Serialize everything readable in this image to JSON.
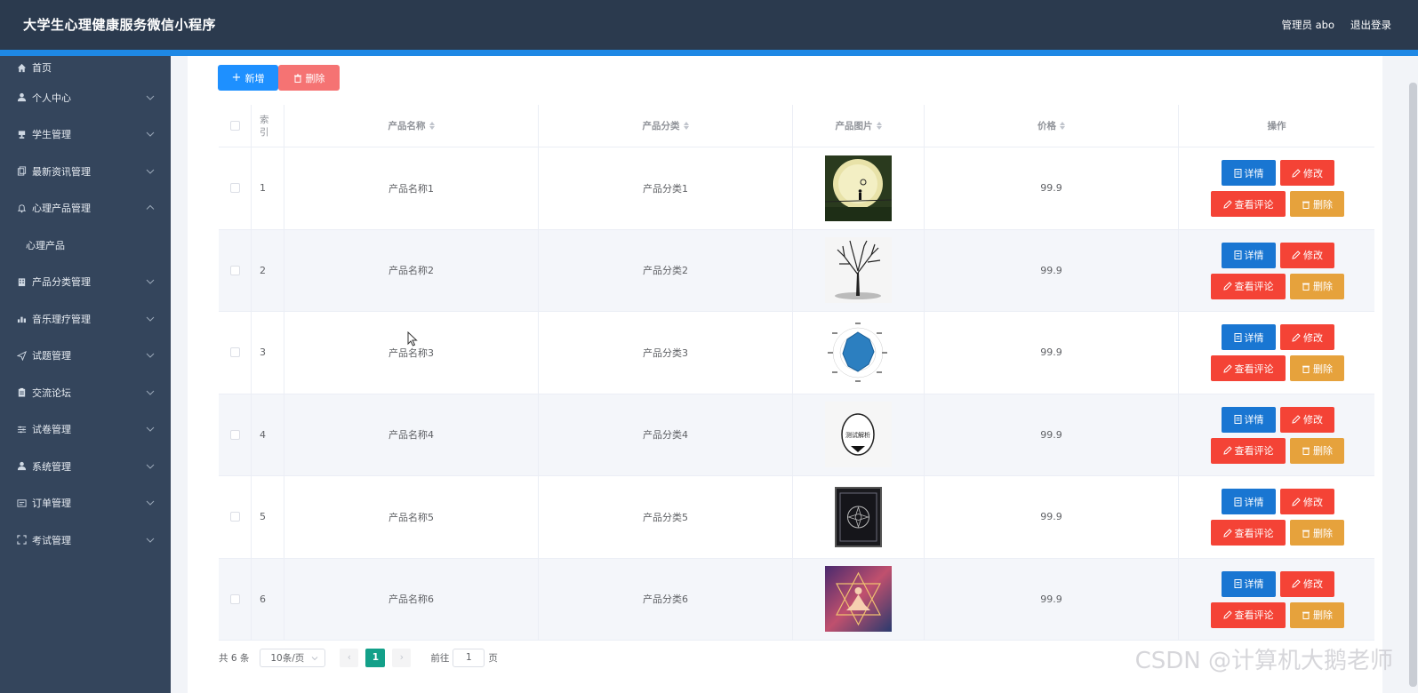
{
  "app": {
    "title": "大学生心理健康服务微信小程序"
  },
  "header": {
    "user_label": "管理员 abo",
    "logout_label": "退出登录"
  },
  "sidebar": {
    "items": [
      {
        "label": "首页",
        "icon": "home-icon",
        "expandable": false
      },
      {
        "label": "个人中心",
        "icon": "user-icon",
        "expandable": true
      },
      {
        "label": "学生管理",
        "icon": "trophy-icon",
        "expandable": true
      },
      {
        "label": "最新资讯管理",
        "icon": "copy-icon",
        "expandable": true
      },
      {
        "label": "心理产品管理",
        "icon": "bell-icon",
        "expandable": true,
        "expanded": true
      },
      {
        "label": "心理产品",
        "icon": "",
        "expandable": false,
        "sub": true
      },
      {
        "label": "产品分类管理",
        "icon": "building-icon",
        "expandable": true
      },
      {
        "label": "音乐理疗管理",
        "icon": "chart-icon",
        "expandable": true
      },
      {
        "label": "试题管理",
        "icon": "send-icon",
        "expandable": true
      },
      {
        "label": "交流论坛",
        "icon": "clipboard-icon",
        "expandable": true
      },
      {
        "label": "试卷管理",
        "icon": "sliders-icon",
        "expandable": true
      },
      {
        "label": "系统管理",
        "icon": "user-icon",
        "expandable": true
      },
      {
        "label": "订单管理",
        "icon": "list-icon",
        "expandable": true
      },
      {
        "label": "考试管理",
        "icon": "expand-icon",
        "expandable": true
      }
    ]
  },
  "toolbar": {
    "add_label": "新增",
    "delete_label": "删除"
  },
  "table": {
    "columns": {
      "index": "索引",
      "name": "产品名称",
      "category": "产品分类",
      "image": "产品图片",
      "price": "价格",
      "actions": "操作"
    },
    "rows": [
      {
        "index": "1",
        "name": "产品名称1",
        "category": "产品分类1",
        "image": "moon-night-thumbnail",
        "price": "99.9"
      },
      {
        "index": "2",
        "name": "产品名称2",
        "category": "产品分类2",
        "image": "bare-tree-thumbnail",
        "price": "99.9"
      },
      {
        "index": "3",
        "name": "产品名称3",
        "category": "产品分类3",
        "image": "radar-chart-thumbnail",
        "price": "99.9"
      },
      {
        "index": "4",
        "name": "产品名称4",
        "category": "产品分类4",
        "image": "test-analysis-thumbnail",
        "price": "99.9"
      },
      {
        "index": "5",
        "name": "产品名称5",
        "category": "产品分类5",
        "image": "mandala-tapestry-thumbnail",
        "price": "99.9"
      },
      {
        "index": "6",
        "name": "产品名称6",
        "category": "产品分类6",
        "image": "meditation-thumbnail",
        "price": "99.9"
      }
    ],
    "actions": {
      "detail": "详情",
      "edit": "修改",
      "review": "查看评论",
      "remove": "删除"
    },
    "image_text": {
      "test_analysis": "测试解析"
    }
  },
  "pagination": {
    "total": "共 6 条",
    "page_size": "10条/页",
    "current_page": "1",
    "goto_prefix": "前往",
    "goto_value": "1",
    "goto_suffix": "页"
  },
  "watermark": "CSDN @计算机大鹅老师",
  "colors": {
    "header": "#2b3a4e",
    "sidebar": "#34455c",
    "primary": "#1976d2",
    "danger": "#f44336",
    "warning": "#e6a23c",
    "page_active": "#13a089"
  }
}
